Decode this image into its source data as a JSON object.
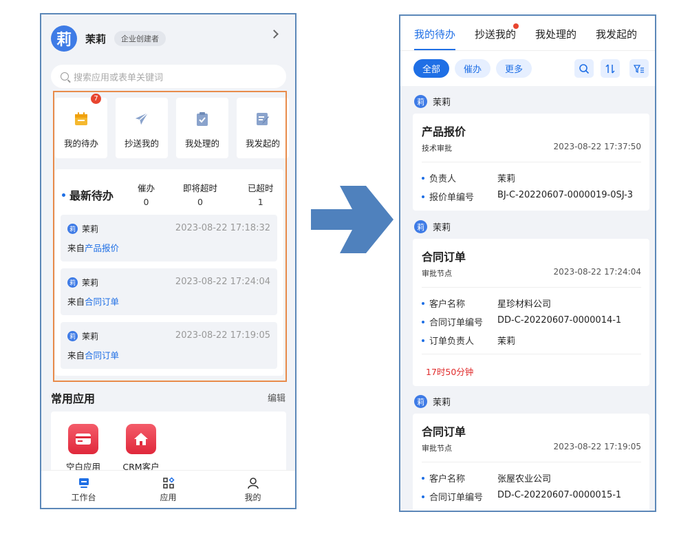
{
  "left": {
    "user": {
      "avatar": "莉",
      "name": "茉莉",
      "role": "企业创建者"
    },
    "search_placeholder": "搜索应用或表单关键词",
    "quick": [
      {
        "label": "我的待办",
        "badge": "7",
        "icon": "calendar-icon"
      },
      {
        "label": "抄送我的",
        "icon": "send-icon"
      },
      {
        "label": "我处理的",
        "icon": "clipboard-check-icon"
      },
      {
        "label": "我发起的",
        "icon": "edit-doc-icon"
      }
    ],
    "todo": {
      "title": "最新待办",
      "stats": [
        {
          "label": "催办",
          "value": "0"
        },
        {
          "label": "即将超时",
          "value": "0"
        },
        {
          "label": "已超时",
          "value": "1"
        }
      ],
      "items": [
        {
          "avatar": "莉",
          "name": "茉莉",
          "time": "2023-08-22 17:18:32",
          "prefix": "来自",
          "source": "产品报价"
        },
        {
          "avatar": "莉",
          "name": "茉莉",
          "time": "2023-08-22 17:24:04",
          "prefix": "来自",
          "source": "合同订单"
        },
        {
          "avatar": "莉",
          "name": "茉莉",
          "time": "2023-08-22 17:19:05",
          "prefix": "来自",
          "source": "合同订单"
        }
      ]
    },
    "common_apps": {
      "title": "常用应用",
      "edit": "编辑",
      "apps": [
        {
          "label": "空白应用",
          "icon": "card-icon"
        },
        {
          "label": "CRM客户",
          "icon": "home-icon"
        }
      ]
    },
    "tabbar": [
      {
        "label": "工作台",
        "icon": "monitor-icon",
        "active": true
      },
      {
        "label": "应用",
        "icon": "grid-icon",
        "active": false
      },
      {
        "label": "我的",
        "icon": "user-icon",
        "active": false
      }
    ]
  },
  "right": {
    "tabs": [
      "我的待办",
      "抄送我的",
      "我处理的",
      "我发起的"
    ],
    "filters": [
      "全部",
      "催办",
      "更多"
    ],
    "groups": [
      {
        "avatar": "莉",
        "name": "茉莉",
        "title": "产品报价",
        "node": "技术审批",
        "time": "2023-08-22 17:37:50",
        "fields": [
          {
            "k": "负责人",
            "v": "茉莉"
          },
          {
            "k": "报价单编号",
            "v": "BJ-C-20220607-0000019-0SJ-3"
          }
        ]
      },
      {
        "avatar": "莉",
        "name": "茉莉",
        "title": "合同订单",
        "node": "审批节点",
        "time": "2023-08-22 17:24:04",
        "fields": [
          {
            "k": "客户名称",
            "v": "星珍材料公司"
          },
          {
            "k": "合同订单编号",
            "v": "DD-C-20220607-0000014-1"
          },
          {
            "k": "订单负责人",
            "v": "茉莉"
          }
        ],
        "warning": "17时50分钟"
      },
      {
        "avatar": "莉",
        "name": "茉莉",
        "title": "合同订单",
        "node": "审批节点",
        "time": "2023-08-22 17:19:05",
        "fields": [
          {
            "k": "客户名称",
            "v": "张屋农业公司"
          },
          {
            "k": "合同订单编号",
            "v": "DD-C-20220607-0000015-1"
          }
        ]
      }
    ]
  },
  "colors": {
    "accent": "#1f6fe5",
    "highlight": "#e88b4a",
    "frame": "#5b87b8",
    "arrow": "#4f81bd",
    "danger": "#e02b2b"
  }
}
